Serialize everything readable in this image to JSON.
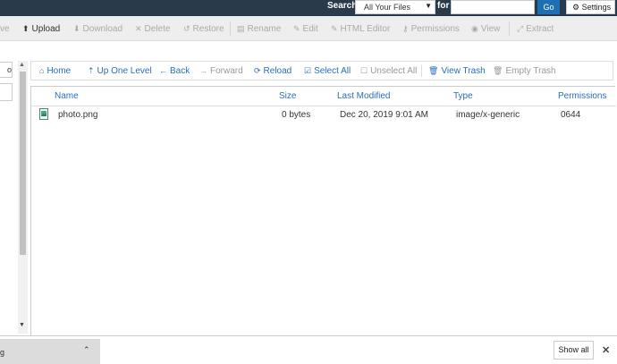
{
  "header": {
    "search_label": "Search",
    "scope_value": "All Your Files",
    "for_label": "for",
    "search_value": "",
    "go_label": "Go",
    "settings_label": "Settings",
    "bg_color": "#293a4a",
    "go_color": "#1f6fb5"
  },
  "toolbar": {
    "items": [
      {
        "label": "ve",
        "icon": "",
        "active": false
      },
      {
        "label": "Upload",
        "icon": "upload-icon",
        "active": true
      },
      {
        "label": "Download",
        "icon": "download-icon",
        "active": false
      },
      {
        "label": "Delete",
        "icon": "times-icon",
        "active": false
      },
      {
        "label": "Restore",
        "icon": "restore-icon",
        "active": false
      },
      {
        "label": "Rename",
        "icon": "rename-icon",
        "active": false
      },
      {
        "label": "Edit",
        "icon": "pencil-icon",
        "active": false
      },
      {
        "label": "HTML Editor",
        "icon": "html-editor-icon",
        "active": false
      },
      {
        "label": "Permissions",
        "icon": "key-icon",
        "active": false
      },
      {
        "label": "View",
        "icon": "eye-icon",
        "active": false
      },
      {
        "label": "Extract",
        "icon": "expand-icon",
        "active": false
      }
    ]
  },
  "tree": {
    "input_text": "o"
  },
  "nav": {
    "items": [
      {
        "label": "Home",
        "icon": "home-icon",
        "enabled": true
      },
      {
        "label": "Up One Level",
        "icon": "level-up-icon",
        "enabled": true
      },
      {
        "label": "Back",
        "icon": "arrow-left-icon",
        "enabled": true
      },
      {
        "label": "Forward",
        "icon": "arrow-right-icon",
        "enabled": false
      },
      {
        "label": "Reload",
        "icon": "refresh-icon",
        "enabled": true
      },
      {
        "label": "Select All",
        "icon": "checkbox-checked-icon",
        "enabled": true
      },
      {
        "label": "Unselect All",
        "icon": "checkbox-empty-icon",
        "enabled": false
      },
      {
        "label": "View Trash",
        "icon": "trash-icon",
        "enabled": true
      },
      {
        "label": "Empty Trash",
        "icon": "trash-icon",
        "enabled": false
      }
    ]
  },
  "table": {
    "columns": [
      "Name",
      "Size",
      "Last Modified",
      "Type",
      "Permissions"
    ],
    "rows": [
      {
        "name": "photo.png",
        "size": "0 bytes",
        "modified": "Dec 20, 2019 9:01 AM",
        "type": "image/x-generic",
        "perms": "0644"
      }
    ]
  },
  "downloads": {
    "item_name": "g",
    "show_all_label": "Show all",
    "close_glyph": "✕"
  }
}
